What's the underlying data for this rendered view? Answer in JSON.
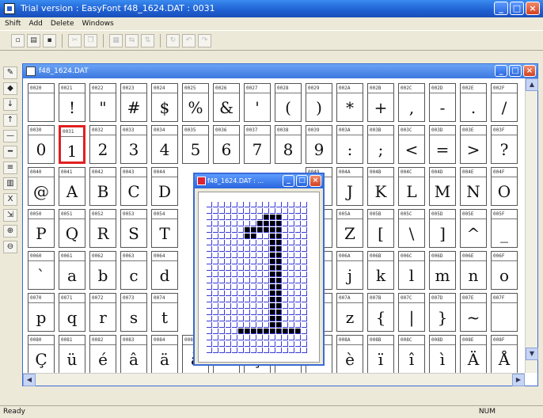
{
  "window": {
    "title": "Trial version : EasyFont   f48_1624.DAT : 0031"
  },
  "menu": [
    "Shift",
    "Add",
    "Delete",
    "Windows"
  ],
  "mdi": {
    "title": "f48_1624.DAT"
  },
  "popup": {
    "title": "f48_1624.DAT : ..."
  },
  "status": {
    "left": "Ready",
    "right": "NUM"
  },
  "colors": {
    "title": "#1e5fd1",
    "selection": "#e02020",
    "gridline": "#3a3ad8"
  },
  "table": {
    "rows": [
      {
        "codes": [
          "0020",
          "0021",
          "0022",
          "0023",
          "0024",
          "0025",
          "0026",
          "0027",
          "0028",
          "0029",
          "002A",
          "002B",
          "002C",
          "002D",
          "002E",
          "002F"
        ],
        "glyphs": [
          " ",
          "!",
          "\"",
          "#",
          "$",
          "%",
          "&",
          "'",
          "(",
          ")",
          "*",
          "+",
          ",",
          "-",
          ".",
          "/"
        ]
      },
      {
        "codes": [
          "0030",
          "0031",
          "0032",
          "0033",
          "0034",
          "0035",
          "0036",
          "0037",
          "0038",
          "0039",
          "003A",
          "003B",
          "003C",
          "003D",
          "003E",
          "003F"
        ],
        "glyphs": [
          "0",
          "1",
          "2",
          "3",
          "4",
          "5",
          "6",
          "7",
          "8",
          "9",
          ":",
          ";",
          "<",
          "=",
          ">",
          "?"
        ]
      },
      {
        "codes": [
          "0040",
          "0041",
          "0042",
          "0043",
          "0044",
          "",
          "",
          "",
          "",
          "0049",
          "004A",
          "004B",
          "004C",
          "004D",
          "004E",
          "004F"
        ],
        "glyphs": [
          "@",
          "A",
          "B",
          "C",
          "D",
          "",
          "",
          "",
          "",
          "I",
          "J",
          "K",
          "L",
          "M",
          "N",
          "O"
        ]
      },
      {
        "codes": [
          "0050",
          "0051",
          "0052",
          "0053",
          "0054",
          "",
          "",
          "",
          "",
          "0059",
          "005A",
          "005B",
          "005C",
          "005D",
          "005E",
          "005F"
        ],
        "glyphs": [
          "P",
          "Q",
          "R",
          "S",
          "T",
          "",
          "",
          "",
          "",
          "Y",
          "Z",
          "[",
          "\\",
          "]",
          "^",
          "_"
        ]
      },
      {
        "codes": [
          "0060",
          "0061",
          "0062",
          "0063",
          "0064",
          "",
          "",
          "",
          "",
          "0069",
          "006A",
          "006B",
          "006C",
          "006D",
          "006E",
          "006F"
        ],
        "glyphs": [
          "`",
          "a",
          "b",
          "c",
          "d",
          "",
          "",
          "",
          "",
          "i",
          "j",
          "k",
          "l",
          "m",
          "n",
          "o"
        ]
      },
      {
        "codes": [
          "0070",
          "0071",
          "0072",
          "0073",
          "0074",
          "",
          "",
          "",
          "",
          "0079",
          "007A",
          "007B",
          "007C",
          "007D",
          "007E",
          "007F"
        ],
        "glyphs": [
          "p",
          "q",
          "r",
          "s",
          "t",
          "",
          "",
          "",
          "",
          "y",
          "z",
          "{",
          "|",
          "}",
          "~",
          ""
        ]
      },
      {
        "codes": [
          "0080",
          "0081",
          "0082",
          "0083",
          "0084",
          "0085",
          "0086",
          "0087",
          "0088",
          "0089",
          "008A",
          "008B",
          "008C",
          "008D",
          "008E",
          "008F"
        ],
        "glyphs": [
          "Ç",
          "ü",
          "é",
          "â",
          "ä",
          "à",
          "å",
          "ç",
          "ê",
          "ë",
          "è",
          "ï",
          "î",
          "ì",
          "Ä",
          "Å"
        ]
      }
    ]
  },
  "selected_code": "0031",
  "bitmap_rows": [
    "0000000000000000",
    "0000000000000000",
    "0000000001110000",
    "0000000011110000",
    "0000001111110000",
    "0000001100110000",
    "0000000000110000",
    "0000000000110000",
    "0000000000110000",
    "0000000000110000",
    "0000000000110000",
    "0000000000110000",
    "0000000000110000",
    "0000000000110000",
    "0000000000110000",
    "0000000000110000",
    "0000000000110000",
    "0000000000110000",
    "0000000000110000",
    "0000000000110000",
    "0000011111111110",
    "0000000000000000",
    "0000000000000000",
    "0000000000000000"
  ]
}
